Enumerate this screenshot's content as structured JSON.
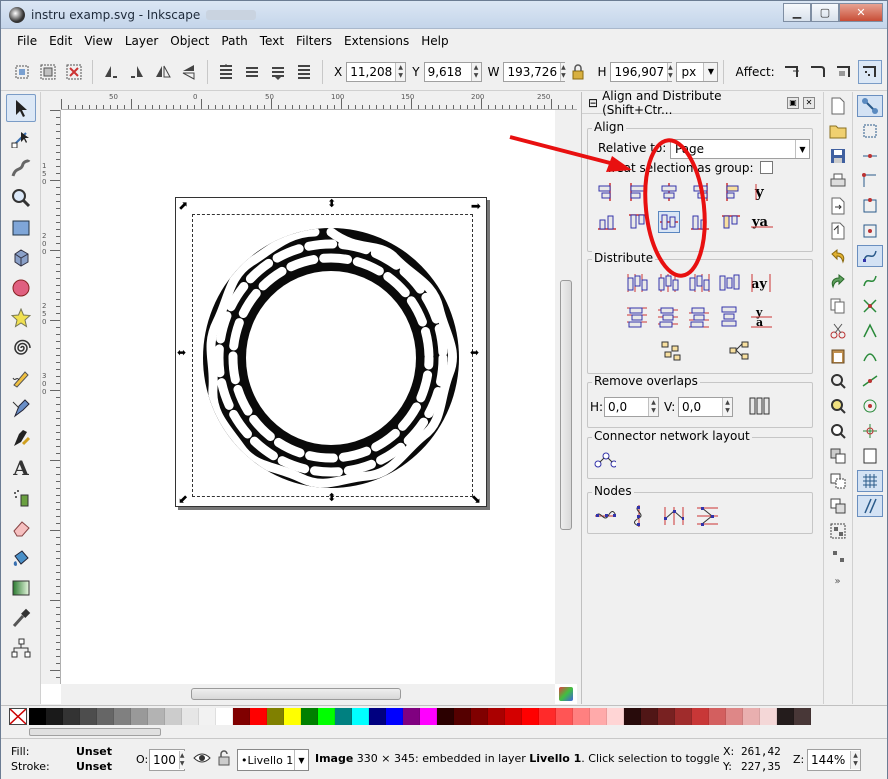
{
  "window": {
    "title": "instru examp.svg - Inkscape",
    "controls": {
      "minimize": "▭",
      "maximize": "▢",
      "close": "✕"
    }
  },
  "menubar": {
    "items": [
      "File",
      "Edit",
      "View",
      "Layer",
      "Object",
      "Path",
      "Text",
      "Filters",
      "Extensions",
      "Help"
    ]
  },
  "controls_bar": {
    "x_label": "X",
    "x_value": "11,208",
    "y_label": "Y",
    "y_value": "9,618",
    "w_label": "W",
    "w_value": "193,726",
    "h_label": "H",
    "h_value": "196,907",
    "unit": "px",
    "affect_label": "Affect:"
  },
  "ruler": {
    "top_labels": [
      "50",
      "0",
      "50",
      "100",
      "150",
      "200",
      "250"
    ],
    "left_labels": [
      "1 5 0",
      "2 0 0",
      "2 5 0",
      "3 0 0"
    ]
  },
  "align_dialog": {
    "title": "Align and Distribute (Shift+Ctr...",
    "align_section": "Align",
    "relative_to_label": "Relative to:",
    "relative_to_value": "Page",
    "treat_group_label": "Treat selection as group:",
    "distribute_section": "Distribute",
    "remove_overlaps_section": "Remove overlaps",
    "h_label": "H:",
    "h_value": "0,0",
    "v_label": "V:",
    "v_value": "0,0",
    "connector_section": "Connector network layout",
    "nodes_section": "Nodes"
  },
  "palette": {
    "colors": [
      "#000000",
      "#1a1a1a",
      "#333333",
      "#4d4d4d",
      "#666666",
      "#808080",
      "#999999",
      "#b3b3b3",
      "#cccccc",
      "#e6e6e6",
      "#f2f2f2",
      "#ffffff",
      "#800000",
      "#ff0000",
      "#808000",
      "#ffff00",
      "#008000",
      "#00ff00",
      "#008080",
      "#00ffff",
      "#000080",
      "#0000ff",
      "#800080",
      "#ff00ff",
      "#2b0000",
      "#550000",
      "#800000",
      "#aa0000",
      "#d40000",
      "#ff0000",
      "#ff2a2a",
      "#ff5555",
      "#ff8080",
      "#ffaaaa",
      "#ffd5d5",
      "#280b0b",
      "#501616",
      "#782121",
      "#a02c2c",
      "#c83737",
      "#d35f5f",
      "#de8787",
      "#e9afaf",
      "#f4d7d7",
      "#241c1c",
      "#483737"
    ]
  },
  "statusbar": {
    "fill_label": "Fill:",
    "fill_value": "Unset",
    "stroke_label": "Stroke:",
    "stroke_value": "Unset",
    "opacity_label": "O:",
    "opacity_value": "100",
    "layer_value": "•Livello 1",
    "message_bold": "Image",
    "message_rest": " 330 × 345: embedded in layer ",
    "message_layer": "Livello 1",
    "message_tail": ". Click selection to toggle scale/",
    "x_label": "X:",
    "x_value": "261,42",
    "y_label": "Y:",
    "y_value": "227,35",
    "z_label": "Z:",
    "zoom_value": "144%"
  },
  "annotation": {
    "arrow_color": "#e81010",
    "ellipse_color": "#e81010"
  }
}
